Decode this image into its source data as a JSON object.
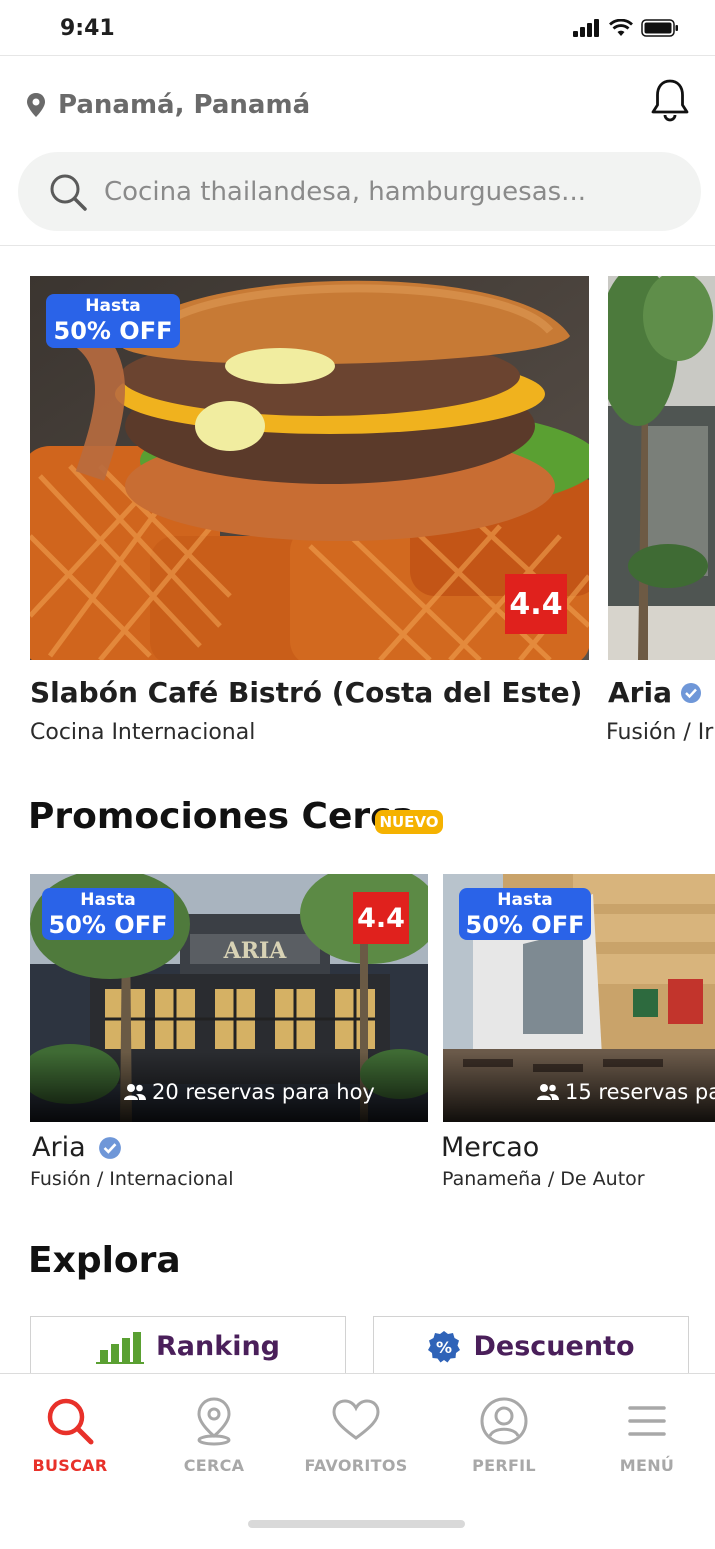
{
  "status_bar": {
    "time": "9:41"
  },
  "header": {
    "location": "Panamá, Panamá"
  },
  "search": {
    "placeholder": "Cocina thailandesa, hamburguesas..."
  },
  "featured": [
    {
      "name": "Slabón Café Bistró (Costa del Este)",
      "category": "Cocina Internacional",
      "discount_top": "Hasta",
      "discount_main": "50% OFF",
      "rating": "4.4"
    },
    {
      "name": "Aria",
      "category": "Fusión / Ir",
      "verified": true
    }
  ],
  "promos_section": {
    "title": "Promociones Cerca",
    "tag": "NUEVO"
  },
  "promos": [
    {
      "name": "Aria",
      "category": "Fusión / Internacional",
      "discount_top": "Hasta",
      "discount_main": "50% OFF",
      "rating": "4.4",
      "reservations": "20 reservas para hoy",
      "verified": true
    },
    {
      "name": "Mercao",
      "category": "Panameña / De Autor",
      "discount_top": "Hasta",
      "discount_main": "50% OFF",
      "reservations": "15 reservas par"
    }
  ],
  "explore": {
    "title": "Explora",
    "cards": [
      {
        "label": "Ranking",
        "icon": "bar-chart-icon"
      },
      {
        "label": "Descuento",
        "icon": "percent-badge-icon"
      }
    ]
  },
  "tabs": [
    {
      "label": "BUSCAR",
      "icon": "search-icon",
      "active": true
    },
    {
      "label": "CERCA",
      "icon": "location-pin-icon"
    },
    {
      "label": "FAVORITOS",
      "icon": "heart-icon"
    },
    {
      "label": "PERFIL",
      "icon": "user-icon"
    },
    {
      "label": "MENÚ",
      "icon": "menu-icon"
    }
  ],
  "colors": {
    "accent_red": "#e8312a",
    "badge_blue": "#2a63e8",
    "rating_red": "#e0211d",
    "nuevo_yellow": "#f5b200",
    "explore_purple": "#4a1f5a"
  }
}
